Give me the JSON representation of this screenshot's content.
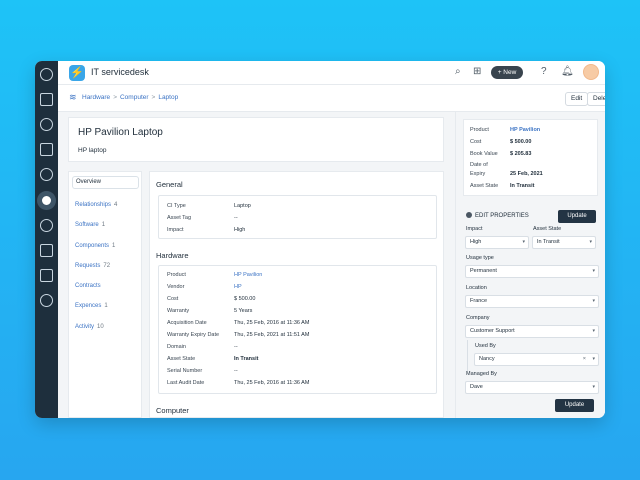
{
  "app": {
    "title": "IT servicedesk",
    "new_label": "+ New"
  },
  "breadcrumb": {
    "items": [
      "Hardware",
      "Computer",
      "Laptop"
    ]
  },
  "header_actions": {
    "edit": "Edit",
    "delete": "Delete"
  },
  "asset": {
    "title": "HP Pavilion Laptop",
    "subtitle": "HP laptop"
  },
  "left_nav": [
    {
      "label": "Overview",
      "count": ""
    },
    {
      "label": "Relationships",
      "count": "4"
    },
    {
      "label": "Software",
      "count": "1"
    },
    {
      "label": "Components",
      "count": "1"
    },
    {
      "label": "Requests",
      "count": "72"
    },
    {
      "label": "Contracts",
      "count": ""
    },
    {
      "label": "Expences",
      "count": "1"
    },
    {
      "label": "Activity",
      "count": "10"
    }
  ],
  "general": {
    "title": "General",
    "rows": [
      {
        "k": "CI Type",
        "v": "Laptop"
      },
      {
        "k": "Asset Tag",
        "v": "--"
      },
      {
        "k": "Impact",
        "v": "High"
      }
    ]
  },
  "hardware": {
    "title": "Hardware",
    "rows": [
      {
        "k": "Product",
        "v": "HP Pavilion"
      },
      {
        "k": "Vendor",
        "v": "HP"
      },
      {
        "k": "Cost",
        "v": "$ 500.00"
      },
      {
        "k": "Warranty",
        "v": "5 Years"
      },
      {
        "k": "Acquisition Date",
        "v": "Thu, 25 Feb, 2016 at 11:36 AM"
      },
      {
        "k": "Warranty Expiry Date",
        "v": "Thu, 25 Feb, 2021 at 11:51 AM"
      },
      {
        "k": "Domain",
        "v": "--"
      },
      {
        "k": "Asset State",
        "v": "In Transit"
      },
      {
        "k": "Serial Number",
        "v": "--"
      },
      {
        "k": "Last Audit Date",
        "v": "Thu, 25 Feb, 2016 at 11:36 AM"
      }
    ]
  },
  "computer": {
    "title": "Computer"
  },
  "summary": {
    "rows": [
      {
        "k": "Product",
        "v": "HP Pavilion"
      },
      {
        "k": "Cost",
        "v": "$ 500.00"
      },
      {
        "k": "Book Value",
        "v": "$ 205.83"
      },
      {
        "k": "Date of Expiry",
        "k1": "Date of",
        "k2": "Expiry",
        "v": "25 Feb, 2021"
      },
      {
        "k": "Asset State",
        "v": "In Transit"
      }
    ]
  },
  "edit_properties": {
    "title": "EDIT PROPERTIES",
    "update": "Update",
    "impact_label": "Impact",
    "impact_value": "High",
    "asset_state_label": "Asset State",
    "asset_state_value": "In Transit",
    "usage_type_label": "Usage type",
    "usage_type_value": "Permanent",
    "location_label": "Location",
    "location_value": "France",
    "company_label": "Company",
    "company_value": "Customer Support",
    "used_by_label": "Used By",
    "used_by_value": "Nancy",
    "managed_by_label": "Managed By",
    "managed_by_value": "Dave"
  },
  "colors": {
    "background": "#1ec3f7",
    "rail": "#1e2f3d",
    "link": "#3b73c4",
    "button_dark": "#233444"
  }
}
